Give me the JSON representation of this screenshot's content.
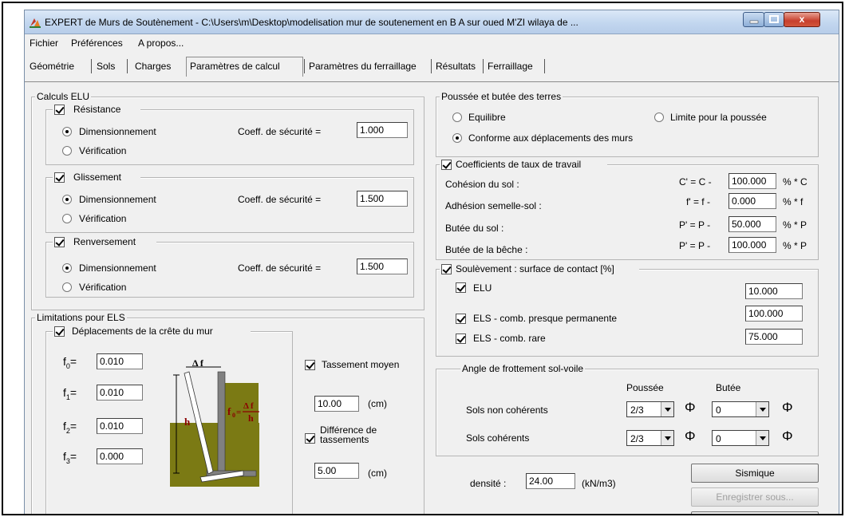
{
  "window": {
    "title": "EXPERT de Murs de Soutènement - C:\\Users\\m\\Desktop\\modelisation mur de soutenement en B A sur oued M'ZI wilaya de ...",
    "close_glyph": "x"
  },
  "menu": [
    "Fichier",
    "Préférences",
    "A propos..."
  ],
  "tabs": [
    "Géométrie",
    "Sols",
    "Charges",
    "Paramètres de calcul",
    "Paramètres du ferraillage",
    "Résultats",
    "Ferraillage"
  ],
  "active_tab": "Paramètres de calcul",
  "elu": {
    "title": "Calculs ELU",
    "groups": [
      {
        "label": "Résistance",
        "checked": true,
        "opt1": "Dimensionnement",
        "opt2": "Vérification",
        "coef_label": "Coeff. de sécurité =",
        "coef": "1.000"
      },
      {
        "label": "Glissement",
        "checked": true,
        "opt1": "Dimensionnement",
        "opt2": "Vérification",
        "coef_label": "Coeff. de sécurité =",
        "coef": "1.500"
      },
      {
        "label": "Renversement",
        "checked": true,
        "opt1": "Dimensionnement",
        "opt2": "Vérification",
        "coef_label": "Coeff. de sécurité =",
        "coef": "1.500"
      }
    ]
  },
  "els": {
    "title": "Limitations pour ELS",
    "crest_label": "Déplacements de la crête du mur",
    "f_labels": [
      "f",
      "f",
      "f",
      "f"
    ],
    "f_subs": [
      "0",
      "1",
      "2",
      "3"
    ],
    "f_values": [
      "0.010",
      "0.010",
      "0.010",
      "0.000"
    ],
    "eq": "=",
    "diagram": {
      "delta": "Δ f",
      "h": "h",
      "frac_lhs": "f",
      "frac_sub": "0",
      "frac_num": "Δ f",
      "frac_den": "h"
    },
    "tassement_label": "Tassement moyen",
    "tassement_value": "10.00",
    "tassement_unit": "(cm)",
    "diff_label_1": "Différence de",
    "diff_label_2": "tassements",
    "diff_value": "5.00",
    "diff_unit": "(cm)"
  },
  "poussee": {
    "title": "Poussée et butée des terres",
    "opt_equilibre": "Equilibre",
    "opt_limite": "Limite pour la poussée",
    "opt_conforme": "Conforme aux déplacements des murs"
  },
  "coef_taux": {
    "title": "Coefficients de taux de travail",
    "rows": [
      {
        "label": "Cohésion du sol :",
        "formula": "C' = C -",
        "value": "100.000",
        "unit": "% * C"
      },
      {
        "label": "Adhésion semelle-sol :",
        "formula": "f' = f -",
        "value": "0.000",
        "unit": "% * f"
      },
      {
        "label": "Butée du sol :",
        "formula": "P' = P -",
        "value": "50.000",
        "unit": "% * P"
      },
      {
        "label": "Butée de la bêche :",
        "formula": "P' = P -",
        "value": "100.000",
        "unit": "% * P"
      }
    ]
  },
  "soulevement": {
    "title": "Soulèvement : surface de contact [%]",
    "rows": [
      {
        "label": "ELU",
        "value": "10.000"
      },
      {
        "label": "ELS - comb. presque permanente",
        "value": "100.000"
      },
      {
        "label": "ELS - comb. rare",
        "value": "75.000"
      }
    ]
  },
  "angle": {
    "title": "Angle de frottement sol-voile",
    "col_poussee": "Poussée",
    "col_butee": "Butée",
    "rows": [
      {
        "label": "Sols non cohérents",
        "poussee": "2/3",
        "butee": "0"
      },
      {
        "label": "Sols cohérents",
        "poussee": "2/3",
        "butee": "0"
      }
    ],
    "phi": "Φ"
  },
  "densite": {
    "label": "densité :",
    "value": "24.00",
    "unit": "(kN/m3)"
  },
  "buttons": {
    "sismique": "Sismique",
    "enregistrer": "Enregistrer sous..."
  },
  "colors": {
    "soil": "#7b7a14",
    "wall": "#808080",
    "diagram_text": "#8b0000"
  }
}
